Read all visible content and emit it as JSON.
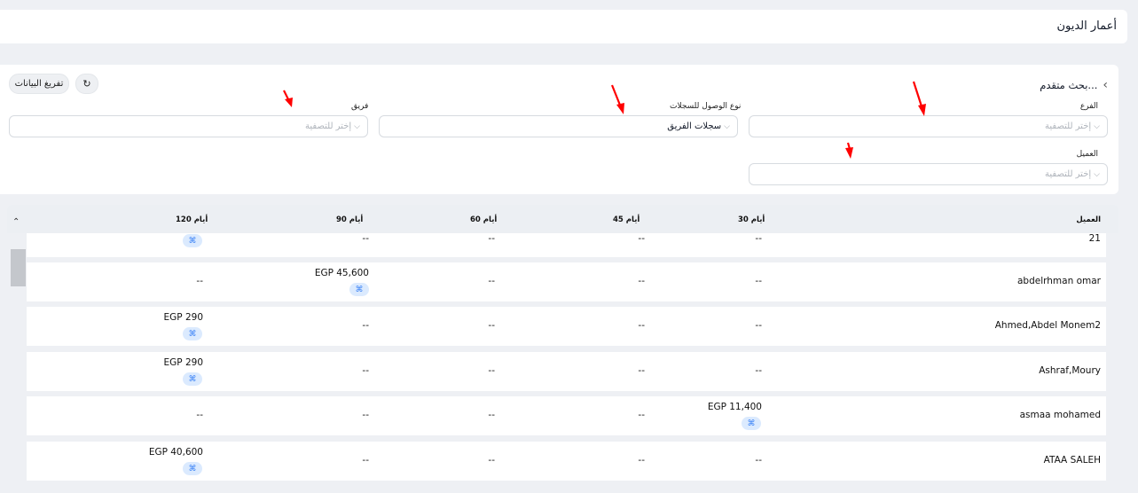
{
  "page": {
    "title": "أعمار الديون"
  },
  "filters": {
    "advanced_search": "بحث متقدم...",
    "export_label": "تفريغ البيانات",
    "refresh_icon": "↻",
    "branch": {
      "label": "الفرع",
      "placeholder": "إختر للتصفية"
    },
    "access_type": {
      "label": "نوع الوصول للسجلات",
      "value": "سجلات الفريق"
    },
    "team": {
      "label": "فريق",
      "placeholder": "إختر للتصفية"
    },
    "customer": {
      "label": "العميل",
      "placeholder": "إختر للتصفية"
    }
  },
  "table": {
    "headers": {
      "customer": "العميل",
      "d30": "30 أيام",
      "d45": "45 أيام",
      "d60": "60 أيام",
      "d90": "90 أيام",
      "d120": "120 أيام"
    },
    "badge_icon": "⌘",
    "rows": [
      {
        "customer": "21",
        "d30": "--",
        "d45": "--",
        "d60": "--",
        "d90": "--",
        "d120": ""
      },
      {
        "customer": "abdelrhman omar",
        "d30": "--",
        "d45": "--",
        "d60": "--",
        "d90": "EGP 45,600",
        "d120": "--"
      },
      {
        "customer": "Ahmed,Abdel Monem2",
        "d30": "--",
        "d45": "--",
        "d60": "--",
        "d90": "--",
        "d120": "EGP 290"
      },
      {
        "customer": "Ashraf,Moury",
        "d30": "--",
        "d45": "--",
        "d60": "--",
        "d90": "--",
        "d120": "EGP 290"
      },
      {
        "customer": "asmaa mohamed",
        "d30": "EGP 11,400",
        "d45": "--",
        "d60": "--",
        "d90": "--",
        "d120": "--"
      },
      {
        "customer": "ATAA SALEH",
        "d30": "--",
        "d45": "--",
        "d60": "--",
        "d90": "--",
        "d120": "EGP 40,600"
      }
    ]
  },
  "colors": {
    "annotation_arrow": "#ff0000",
    "badge_bg": "#dbeafe",
    "badge_fg": "#3b82f6"
  }
}
